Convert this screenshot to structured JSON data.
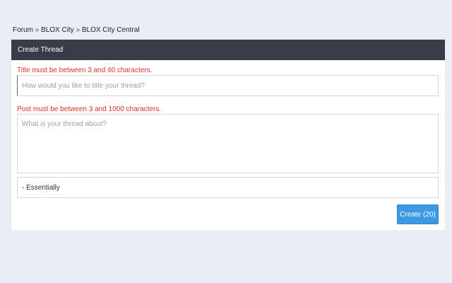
{
  "breadcrumb": {
    "items": [
      "Forum",
      "BLOX City",
      "BLOX City Central"
    ],
    "separator": "»"
  },
  "panel": {
    "title": "Create Thread"
  },
  "form": {
    "title_error": "Title must be between 3 and 40 characters.",
    "title_placeholder": "How would you like to title your thread?",
    "title_value": "",
    "post_error": "Post must be between 3 and 1000 characters.",
    "post_placeholder": "What is your thread about?",
    "post_value": "",
    "signature_value": "- Essentially",
    "create_label": "Create (20)"
  },
  "colors": {
    "page_background": "#eaedf4",
    "header_background": "#383c48",
    "error_text": "#e0321f",
    "button_primary": "#3b9ae6"
  }
}
